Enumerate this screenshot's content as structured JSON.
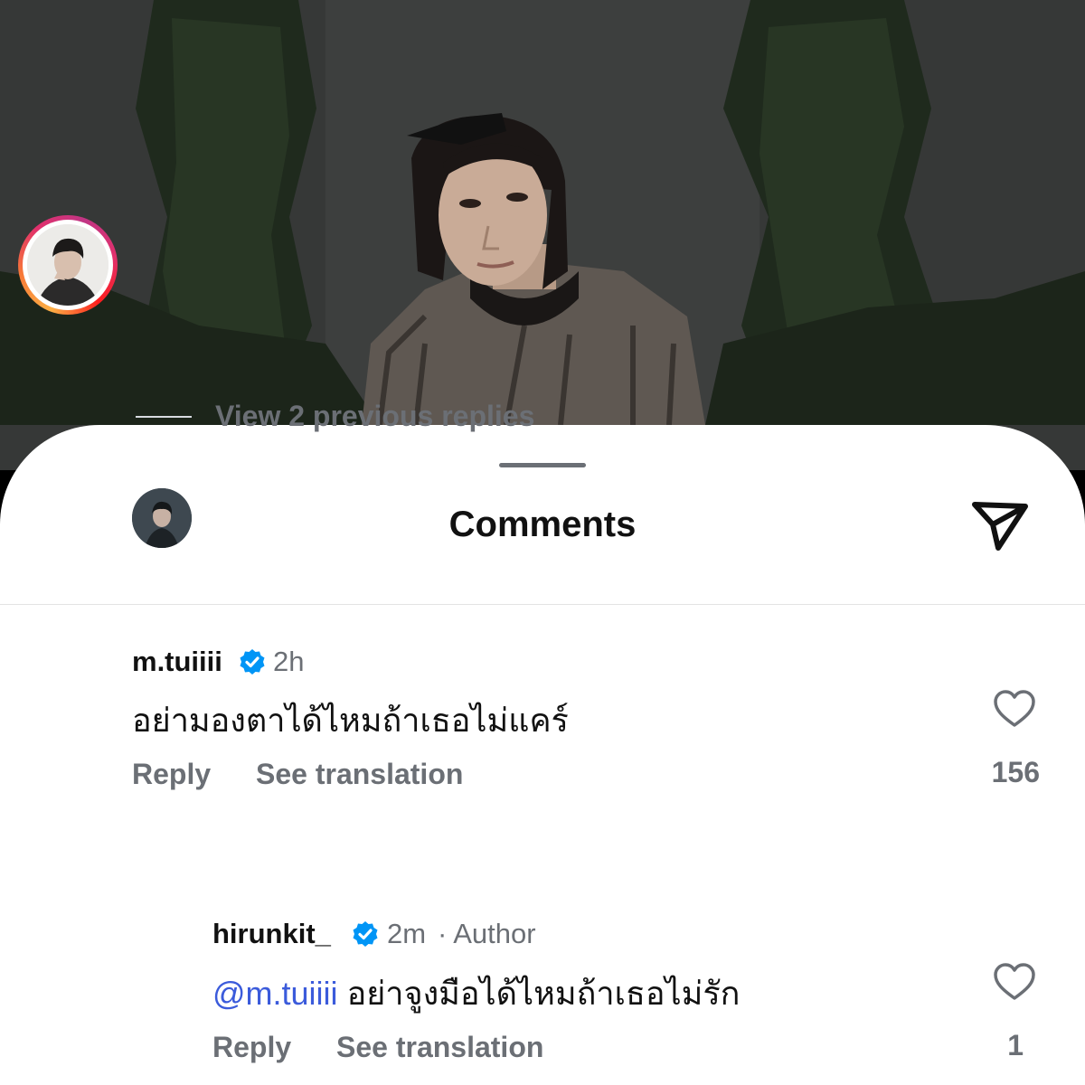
{
  "sheet": {
    "title": "Comments",
    "share_icon": "paper-plane-icon"
  },
  "comments": [
    {
      "username": "m.tuiiii",
      "verified": true,
      "time": "2h",
      "text": "อย่ามองตาได้ไหมถ้าเธอไม่แคร์",
      "reply_label": "Reply",
      "translate_label": "See translation",
      "likes": "156",
      "has_story_ring": true
    }
  ],
  "thread": {
    "view_replies_label": "View 2 previous replies"
  },
  "replies": [
    {
      "username": "hirunkit_",
      "verified": true,
      "time": "2m",
      "author_tag": "· Author",
      "mention": "@m.tuiiii",
      "text": "อย่าจูงมือได้ไหมถ้าเธอไม่รัก",
      "reply_label": "Reply",
      "translate_label": "See translation",
      "likes": "1"
    }
  ],
  "colors": {
    "verified_blue": "#0095f6",
    "mention_blue": "#3b5bdb",
    "secondary_text": "#6b6f75"
  }
}
